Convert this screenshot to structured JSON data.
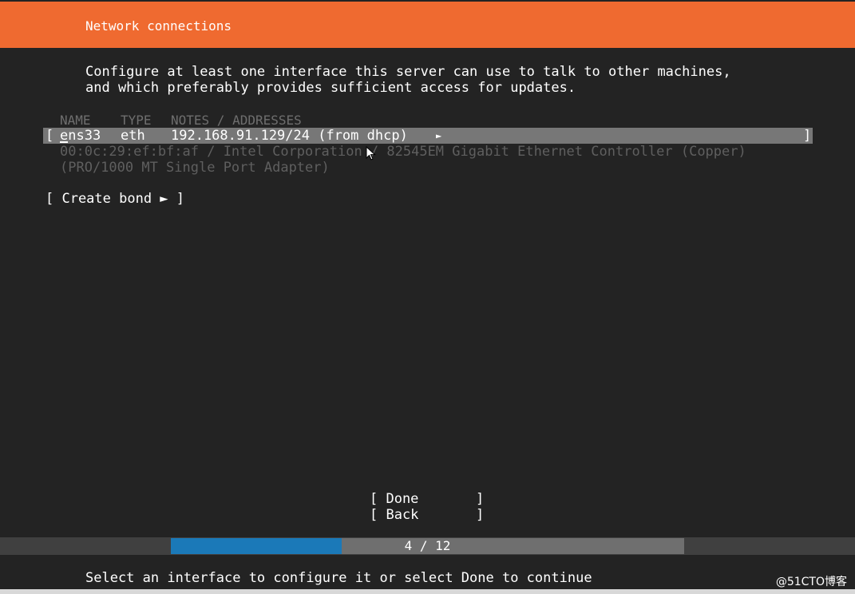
{
  "header": {
    "title": "Network connections"
  },
  "description": {
    "line1": "Configure at least one interface this server can use to talk to other machines,",
    "line2": "and which preferably provides sufficient access for updates."
  },
  "columns": {
    "name": "NAME",
    "type": "TYPE",
    "notes": "NOTES / ADDRESSES"
  },
  "interfaces": [
    {
      "open_bracket": "[",
      "name": "ens33",
      "type": "eth",
      "address": "192.168.91.129/24 (from dhcp)",
      "arrow": "►",
      "close_bracket": "]",
      "detail_line1": "00:0c:29:ef:bf:af / Intel Corporation / 82545EM Gigabit Ethernet Controller (Copper)",
      "detail_line2": "(PRO/1000 MT Single Port Adapter)"
    }
  ],
  "create_bond": {
    "label": "[ Create bond ► ]"
  },
  "buttons": {
    "done": "[ Done       ]",
    "back": "[ Back       ]"
  },
  "progress": {
    "label": "4 / 12",
    "current": 4,
    "total": 12,
    "fill_color": "#1b79b8"
  },
  "footer": {
    "hint": "Select an interface to configure it or select Done to continue"
  },
  "watermark": {
    "text": "@51CTO博客"
  },
  "colors": {
    "header": "#ef6a30",
    "background": "#232323",
    "highlight": "#777777"
  }
}
